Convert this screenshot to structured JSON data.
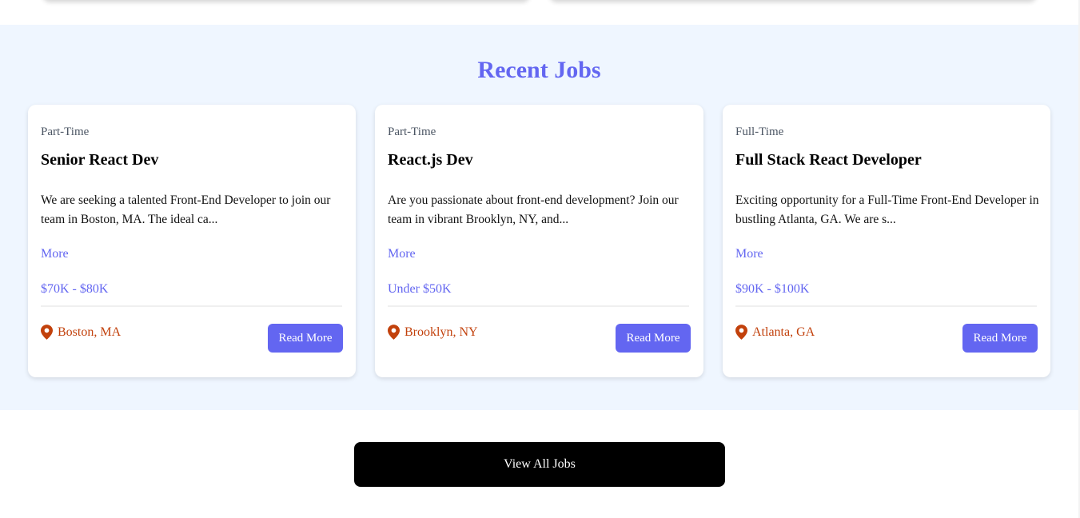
{
  "section": {
    "title": "Recent Jobs"
  },
  "jobs": [
    {
      "type": "Part-Time",
      "title": "Senior React Dev",
      "description": "We are seeking a talented Front-End Developer to join our team in Boston, MA. The ideal ca...",
      "more_label": "More",
      "salary": "$70K - $80K",
      "location": "Boston, MA",
      "button_label": "Read More"
    },
    {
      "type": "Part-Time",
      "title": "React.js Dev",
      "description": "Are you passionate about front-end development? Join our team in vibrant Brooklyn, NY, and...",
      "more_label": "More",
      "salary": "Under $50K",
      "location": "Brooklyn, NY",
      "button_label": "Read More"
    },
    {
      "type": "Full-Time",
      "title": "Full Stack React Developer",
      "description": "Exciting opportunity for a Full-Time Front-End Developer in bustling Atlanta, GA. We are s...",
      "more_label": "More",
      "salary": "$90K - $100K",
      "location": "Atlanta, GA",
      "button_label": "Read More"
    }
  ],
  "footer": {
    "view_all_label": "View All Jobs"
  },
  "icons": {
    "location": "map-marker-icon"
  },
  "colors": {
    "accent": "#6366f1",
    "location": "#c2410c",
    "section_bg": "#eff6ff",
    "view_all_bg": "#000000"
  }
}
